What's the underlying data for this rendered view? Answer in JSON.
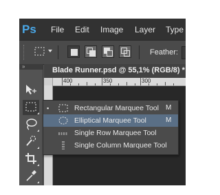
{
  "app": {
    "logo": "Ps"
  },
  "menubar": {
    "items": [
      "File",
      "Edit",
      "Image",
      "Layer",
      "Type"
    ]
  },
  "options_bar": {
    "tool_icon": "rectangular-marquee-icon",
    "selection_modes": [
      "new-selection",
      "add-to-selection",
      "subtract-from-selection",
      "intersect-with-selection"
    ],
    "feather_label": "Feather:"
  },
  "toolbar": {
    "collapse_label": "»",
    "tools": [
      {
        "name": "move-tool",
        "icon": "move-icon",
        "glyph": "↖"
      },
      {
        "name": "marquee-tool",
        "icon": "rectangular-marquee-icon",
        "glyph": "⬚",
        "selected": true
      },
      {
        "name": "lasso-tool",
        "icon": "lasso-icon",
        "glyph": "○"
      },
      {
        "name": "quick-selection-tool",
        "icon": "quick-selection-icon",
        "glyph": "❀"
      },
      {
        "name": "crop-tool",
        "icon": "crop-icon",
        "glyph": "⯐"
      },
      {
        "name": "eyedropper-tool",
        "icon": "eyedropper-icon",
        "glyph": "✐"
      }
    ]
  },
  "document": {
    "tab_title": "Blade Runner.psd @ 55,1% (RGB/8) *",
    "ruler_labels": [
      "400",
      "350",
      "300"
    ]
  },
  "flyout": {
    "items": [
      {
        "bullet": "▪",
        "icon": "rectangular-marquee-icon",
        "label": "Rectangular Marquee Tool",
        "shortcut": "M"
      },
      {
        "bullet": "",
        "icon": "elliptical-marquee-icon",
        "label": "Elliptical Marquee Tool",
        "shortcut": "M",
        "highlighted": true
      },
      {
        "bullet": "",
        "icon": "single-row-marquee-icon",
        "label": "Single Row Marquee Tool",
        "shortcut": ""
      },
      {
        "bullet": "",
        "icon": "single-column-marquee-icon",
        "label": "Single Column Marquee Tool",
        "shortcut": ""
      }
    ]
  },
  "colors": {
    "highlight": "#5a6f86",
    "logo": "#4aa8e8",
    "canvas": "#282828"
  }
}
